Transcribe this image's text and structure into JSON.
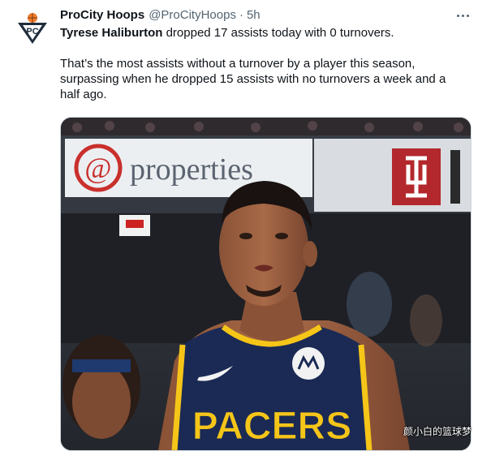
{
  "tweet": {
    "display_name": "ProCity Hoops",
    "handle": "@ProCityHoops",
    "separator": "·",
    "time": "5h",
    "player_name": "Tyrese Haliburton",
    "line1_rest": " dropped 17 assists today with 0 turnovers.",
    "paragraph2": "That’s the most assists without a turnover by a player this season, surpassing when he dropped 15 assists with no turnovers a week and a half ago."
  },
  "media": {
    "banner_left": "@properties",
    "jersey_text": "PACERS",
    "watermark": "颜小白的篮球梦"
  },
  "icons": {
    "avatar": "procity-hoops-logo",
    "more": "more-dots-icon"
  },
  "colors": {
    "accent": "#1d9bf0",
    "text": "#0f1419",
    "muted": "#536471",
    "pacers_navy": "#1b2a55",
    "pacers_gold": "#f5c518",
    "iu_red": "#990000"
  }
}
